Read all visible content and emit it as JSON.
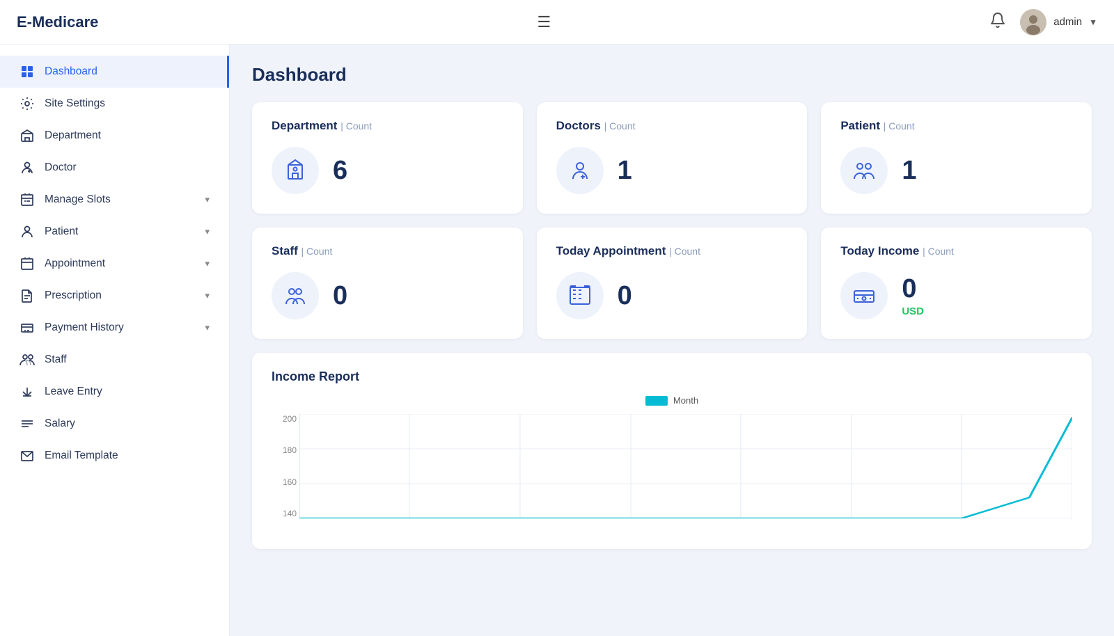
{
  "header": {
    "logo": "E-Medicare",
    "admin_name": "admin",
    "bell_label": "notifications",
    "hamburger_label": "toggle menu"
  },
  "sidebar": {
    "items": [
      {
        "id": "dashboard",
        "label": "Dashboard",
        "icon": "dashboard-icon",
        "active": true,
        "expandable": false
      },
      {
        "id": "site-settings",
        "label": "Site Settings",
        "icon": "settings-icon",
        "active": false,
        "expandable": false
      },
      {
        "id": "department",
        "label": "Department",
        "icon": "department-icon",
        "active": false,
        "expandable": false
      },
      {
        "id": "doctor",
        "label": "Doctor",
        "icon": "doctor-icon",
        "active": false,
        "expandable": false
      },
      {
        "id": "manage-slots",
        "label": "Manage Slots",
        "icon": "slots-icon",
        "active": false,
        "expandable": true
      },
      {
        "id": "patient",
        "label": "Patient",
        "icon": "patient-icon",
        "active": false,
        "expandable": true
      },
      {
        "id": "appointment",
        "label": "Appointment",
        "icon": "appointment-icon",
        "active": false,
        "expandable": true
      },
      {
        "id": "prescription",
        "label": "Prescription",
        "icon": "prescription-icon",
        "active": false,
        "expandable": true
      },
      {
        "id": "payment-history",
        "label": "Payment History",
        "icon": "payment-icon",
        "active": false,
        "expandable": true
      },
      {
        "id": "staff",
        "label": "Staff",
        "icon": "staff-icon",
        "active": false,
        "expandable": false
      },
      {
        "id": "leave-entry",
        "label": "Leave Entry",
        "icon": "leave-icon",
        "active": false,
        "expandable": false
      },
      {
        "id": "salary",
        "label": "Salary",
        "icon": "salary-icon",
        "active": false,
        "expandable": false
      },
      {
        "id": "email-template",
        "label": "Email Template",
        "icon": "email-icon",
        "active": false,
        "expandable": false
      }
    ]
  },
  "stats": {
    "cards": [
      {
        "id": "department-count",
        "title": "Department",
        "count_label": "Count",
        "value": "6",
        "icon": "department-stat-icon"
      },
      {
        "id": "doctors-count",
        "title": "Doctors",
        "count_label": "Count",
        "value": "1",
        "icon": "doctors-stat-icon"
      },
      {
        "id": "patient-count",
        "title": "Patient",
        "count_label": "Count",
        "value": "1",
        "icon": "patient-stat-icon"
      },
      {
        "id": "staff-count",
        "title": "Staff",
        "count_label": "Count",
        "value": "0",
        "icon": "staff-stat-icon"
      },
      {
        "id": "today-appointment-count",
        "title": "Today Appointment",
        "count_label": "Count",
        "value": "0",
        "icon": "appointment-stat-icon"
      },
      {
        "id": "today-income-count",
        "title": "Today Income",
        "count_label": "Count",
        "value": "0",
        "icon": "income-stat-icon",
        "usd_label": "USD"
      }
    ]
  },
  "income_report": {
    "title": "Income Report",
    "legend_label": "Month",
    "y_labels": [
      "200",
      "180",
      "160",
      "140"
    ],
    "chart_color": "#06bcd4"
  }
}
